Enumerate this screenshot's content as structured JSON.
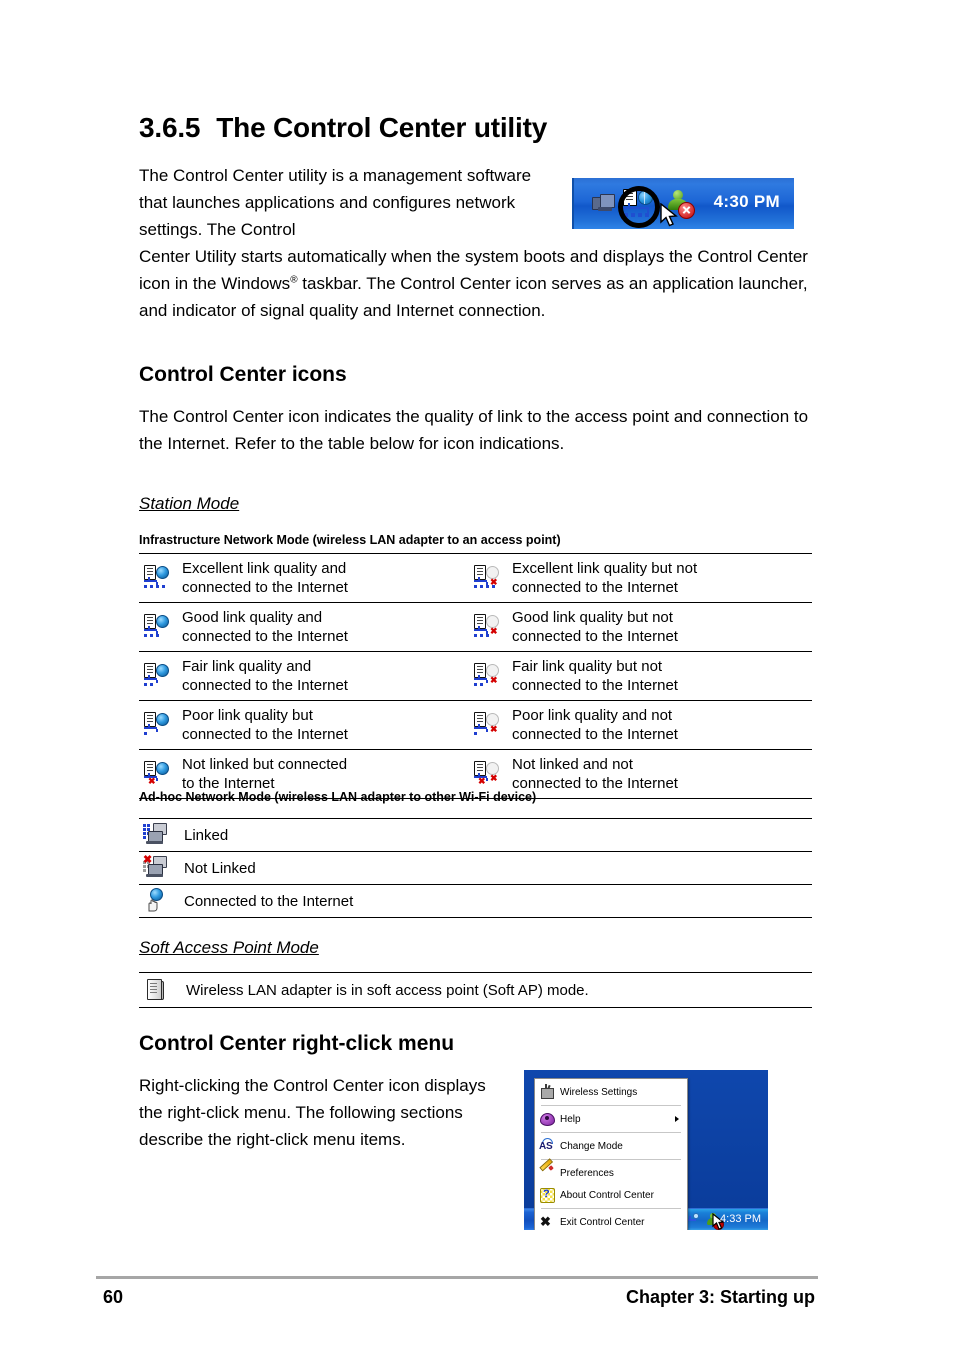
{
  "section": {
    "number": "3.6.5",
    "title": "The Control Center utility",
    "intro_part1": "The Control Center utility is a management software that launches applications and configures network settings. The Control",
    "intro_part2a": "Center Utility starts automatically when the system boots and displays the Control Center icon in the Windows",
    "intro_sup": "®",
    "intro_part2b": " taskbar. The Control Center icon serves as an application launcher, and indicator of signal quality and Internet connection."
  },
  "taskbar_image": {
    "time": "4:30 PM",
    "icons": [
      "network-connection-icon",
      "control-center-icon",
      "user-account-icon"
    ],
    "highlight": "magnifier-ring-highlight"
  },
  "icons_section": {
    "heading": "Control Center icons",
    "paragraph": "The Control Center icon indicates the quality of link to the access point and connection to the Internet. Refer to the table below for icon indications.",
    "station_mode_title": "Station Mode",
    "infrastructure_caption": "Infrastructure Network Mode (wireless LAN adapter to an access point)",
    "infrastructure_rows": [
      {
        "left_line1": "Excellent link quality and",
        "left_line2": "connected to the Internet",
        "left_bars": 4,
        "left_internet": true,
        "right_line1": "Excellent link quality but not",
        "right_line2": "connected to the Internet",
        "right_bars": 4,
        "right_internet": false
      },
      {
        "left_line1": "Good link quality and",
        "left_line2": "connected to the Internet",
        "left_bars": 3,
        "left_internet": true,
        "right_line1": "Good link quality but not",
        "right_line2": "connected to the Internet",
        "right_bars": 3,
        "right_internet": false
      },
      {
        "left_line1": "Fair link quality and",
        "left_line2": "connected to the Internet",
        "left_bars": 2,
        "left_internet": true,
        "right_line1": "Fair link quality but not",
        "right_line2": "connected to the Internet",
        "right_bars": 2,
        "right_internet": false
      },
      {
        "left_line1": "Poor link quality but",
        "left_line2": "connected to the Internet",
        "left_bars": 1,
        "left_internet": true,
        "right_line1": "Poor link quality and not",
        "right_line2": "connected to the Internet",
        "right_bars": 1,
        "right_internet": false
      },
      {
        "left_line1": "Not linked but connected",
        "left_line2": "to the Internet",
        "left_bars": 0,
        "left_internet": true,
        "right_line1": "Not linked and not",
        "right_line2": "connected to the Internet",
        "right_bars": 0,
        "right_internet": false
      }
    ],
    "adhoc_caption": "Ad-hoc Network Mode (wireless LAN adapter to other Wi-Fi device)",
    "adhoc_rows": [
      {
        "label": "Linked",
        "icon": "adhoc-linked-icon"
      },
      {
        "label": "Not Linked",
        "icon": "adhoc-not-linked-icon"
      },
      {
        "label": "Connected to the Internet",
        "icon": "adhoc-internet-icon"
      }
    ],
    "softap_mode_title": "Soft Access Point Mode",
    "softap_rows": [
      {
        "label": "Wireless LAN adapter is in soft access point (Soft AP) mode.",
        "icon": "soft-ap-icon"
      }
    ]
  },
  "rightclick_section": {
    "heading": "Control Center right-click menu",
    "paragraph": "Right-clicking the Control Center icon displays the right-click menu. The following sections describe the right-click menu items."
  },
  "context_menu": {
    "items": [
      {
        "label": "Wireless Settings",
        "icon": "wireless-settings-icon",
        "submenu": false
      },
      {
        "label": "Help",
        "icon": "help-book-icon",
        "submenu": true
      },
      {
        "label": "Change Mode",
        "icon": "change-mode-icon",
        "submenu": false
      },
      {
        "label": "Preferences",
        "icon": "preferences-pencil-icon",
        "submenu": false
      },
      {
        "label": "About Control Center",
        "icon": "about-question-icon",
        "submenu": false
      },
      {
        "label": "Exit Control Center",
        "icon": "exit-x-icon",
        "submenu": false
      }
    ],
    "taskbar_time": "4:33 PM"
  },
  "footer": {
    "page_number": "60",
    "chapter": "Chapter 3: Starting up"
  },
  "colors": {
    "taskbar_blue": "#1157c9",
    "link_blue": "#1f3fd0",
    "error_red": "#d40000",
    "rule_gray": "#a6a6a6"
  }
}
